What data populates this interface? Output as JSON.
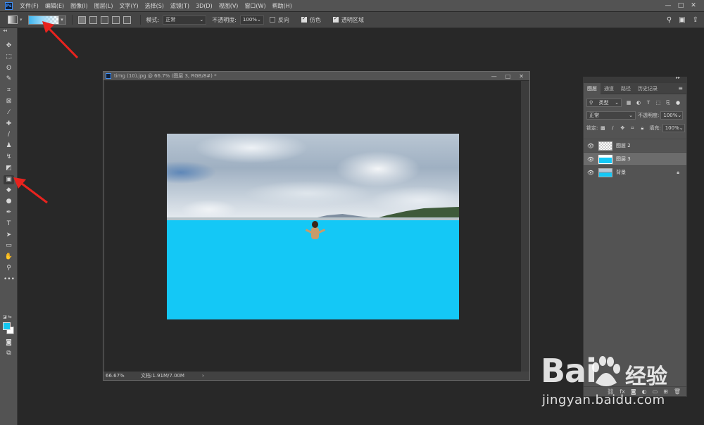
{
  "app": {
    "logo": "Ps"
  },
  "menu": [
    "文件(F)",
    "编辑(E)",
    "图像(I)",
    "图层(L)",
    "文字(Y)",
    "选择(S)",
    "滤镜(T)",
    "3D(D)",
    "视图(V)",
    "窗口(W)",
    "帮助(H)"
  ],
  "window_controls": {
    "minimize": "—",
    "maximize": "□",
    "close": "✕"
  },
  "options": {
    "gradient_colors": [
      "#3fb6f0",
      "#9ad8f8"
    ],
    "mode_label": "模式:",
    "mode_value": "正常",
    "opacity_label": "不透明度:",
    "opacity_value": "100%",
    "reverse_label": "反向",
    "reverse_checked": false,
    "dither_label": "仿色",
    "dither_checked": true,
    "transparency_label": "透明区域",
    "transparency_checked": true
  },
  "toolbar": {
    "active_tool": "gradient-tool",
    "foreground_color": "#14c6f0",
    "background_color": "#ffffff",
    "tools": [
      {
        "name": "move-tool",
        "glyph": "✥"
      },
      {
        "name": "marquee-tool",
        "glyph": "⬚"
      },
      {
        "name": "lasso-tool",
        "glyph": "ʘ"
      },
      {
        "name": "quick-select-tool",
        "glyph": "✎"
      },
      {
        "name": "crop-tool",
        "glyph": "⌗"
      },
      {
        "name": "frame-tool",
        "glyph": "⊠"
      },
      {
        "name": "eyedropper-tool",
        "glyph": "⁄"
      },
      {
        "name": "healing-brush-tool",
        "glyph": "✚"
      },
      {
        "name": "brush-tool",
        "glyph": "∕"
      },
      {
        "name": "stamp-tool",
        "glyph": "♟"
      },
      {
        "name": "history-brush-tool",
        "glyph": "↯"
      },
      {
        "name": "eraser-tool",
        "glyph": "◩"
      },
      {
        "name": "gradient-tool",
        "glyph": "▣"
      },
      {
        "name": "blur-tool",
        "glyph": "◆"
      },
      {
        "name": "dodge-tool",
        "glyph": "●"
      },
      {
        "name": "pen-tool",
        "glyph": "✒"
      },
      {
        "name": "type-tool",
        "glyph": "T"
      },
      {
        "name": "path-select-tool",
        "glyph": "➤"
      },
      {
        "name": "rectangle-tool",
        "glyph": "▭"
      },
      {
        "name": "hand-tool",
        "glyph": "✋"
      },
      {
        "name": "zoom-tool",
        "glyph": "⚲"
      },
      {
        "name": "more-tools",
        "glyph": "•••"
      }
    ]
  },
  "document": {
    "title": "timg (10).jpg @ 66.7% (图层 3, RGB/8#) *",
    "zoom": "66.67%",
    "info": "文档:1.91M/7.00M",
    "info_arrow": "›"
  },
  "image_colors": {
    "sea": "#14c8f6"
  },
  "layers_panel": {
    "tabs": [
      "图层",
      "通道",
      "路径",
      "历史记录"
    ],
    "active_tab": "图层",
    "filter_label": "类型",
    "blend_mode": "正常",
    "opacity_label": "不透明度:",
    "opacity_value": "100%",
    "lock_label": "锁定:",
    "fill_label": "填充:",
    "fill_value": "100%",
    "layers": [
      {
        "name": "图层 2",
        "thumb": "transparent",
        "selected": false,
        "locked": false
      },
      {
        "name": "图层 3",
        "thumb": "cyan",
        "selected": true,
        "locked": false
      },
      {
        "name": "背景",
        "thumb": "photo",
        "selected": false,
        "locked": true
      }
    ]
  },
  "watermark": {
    "brand": "Bai",
    "suffix": "经验",
    "url": "jingyan.baidu.com"
  }
}
